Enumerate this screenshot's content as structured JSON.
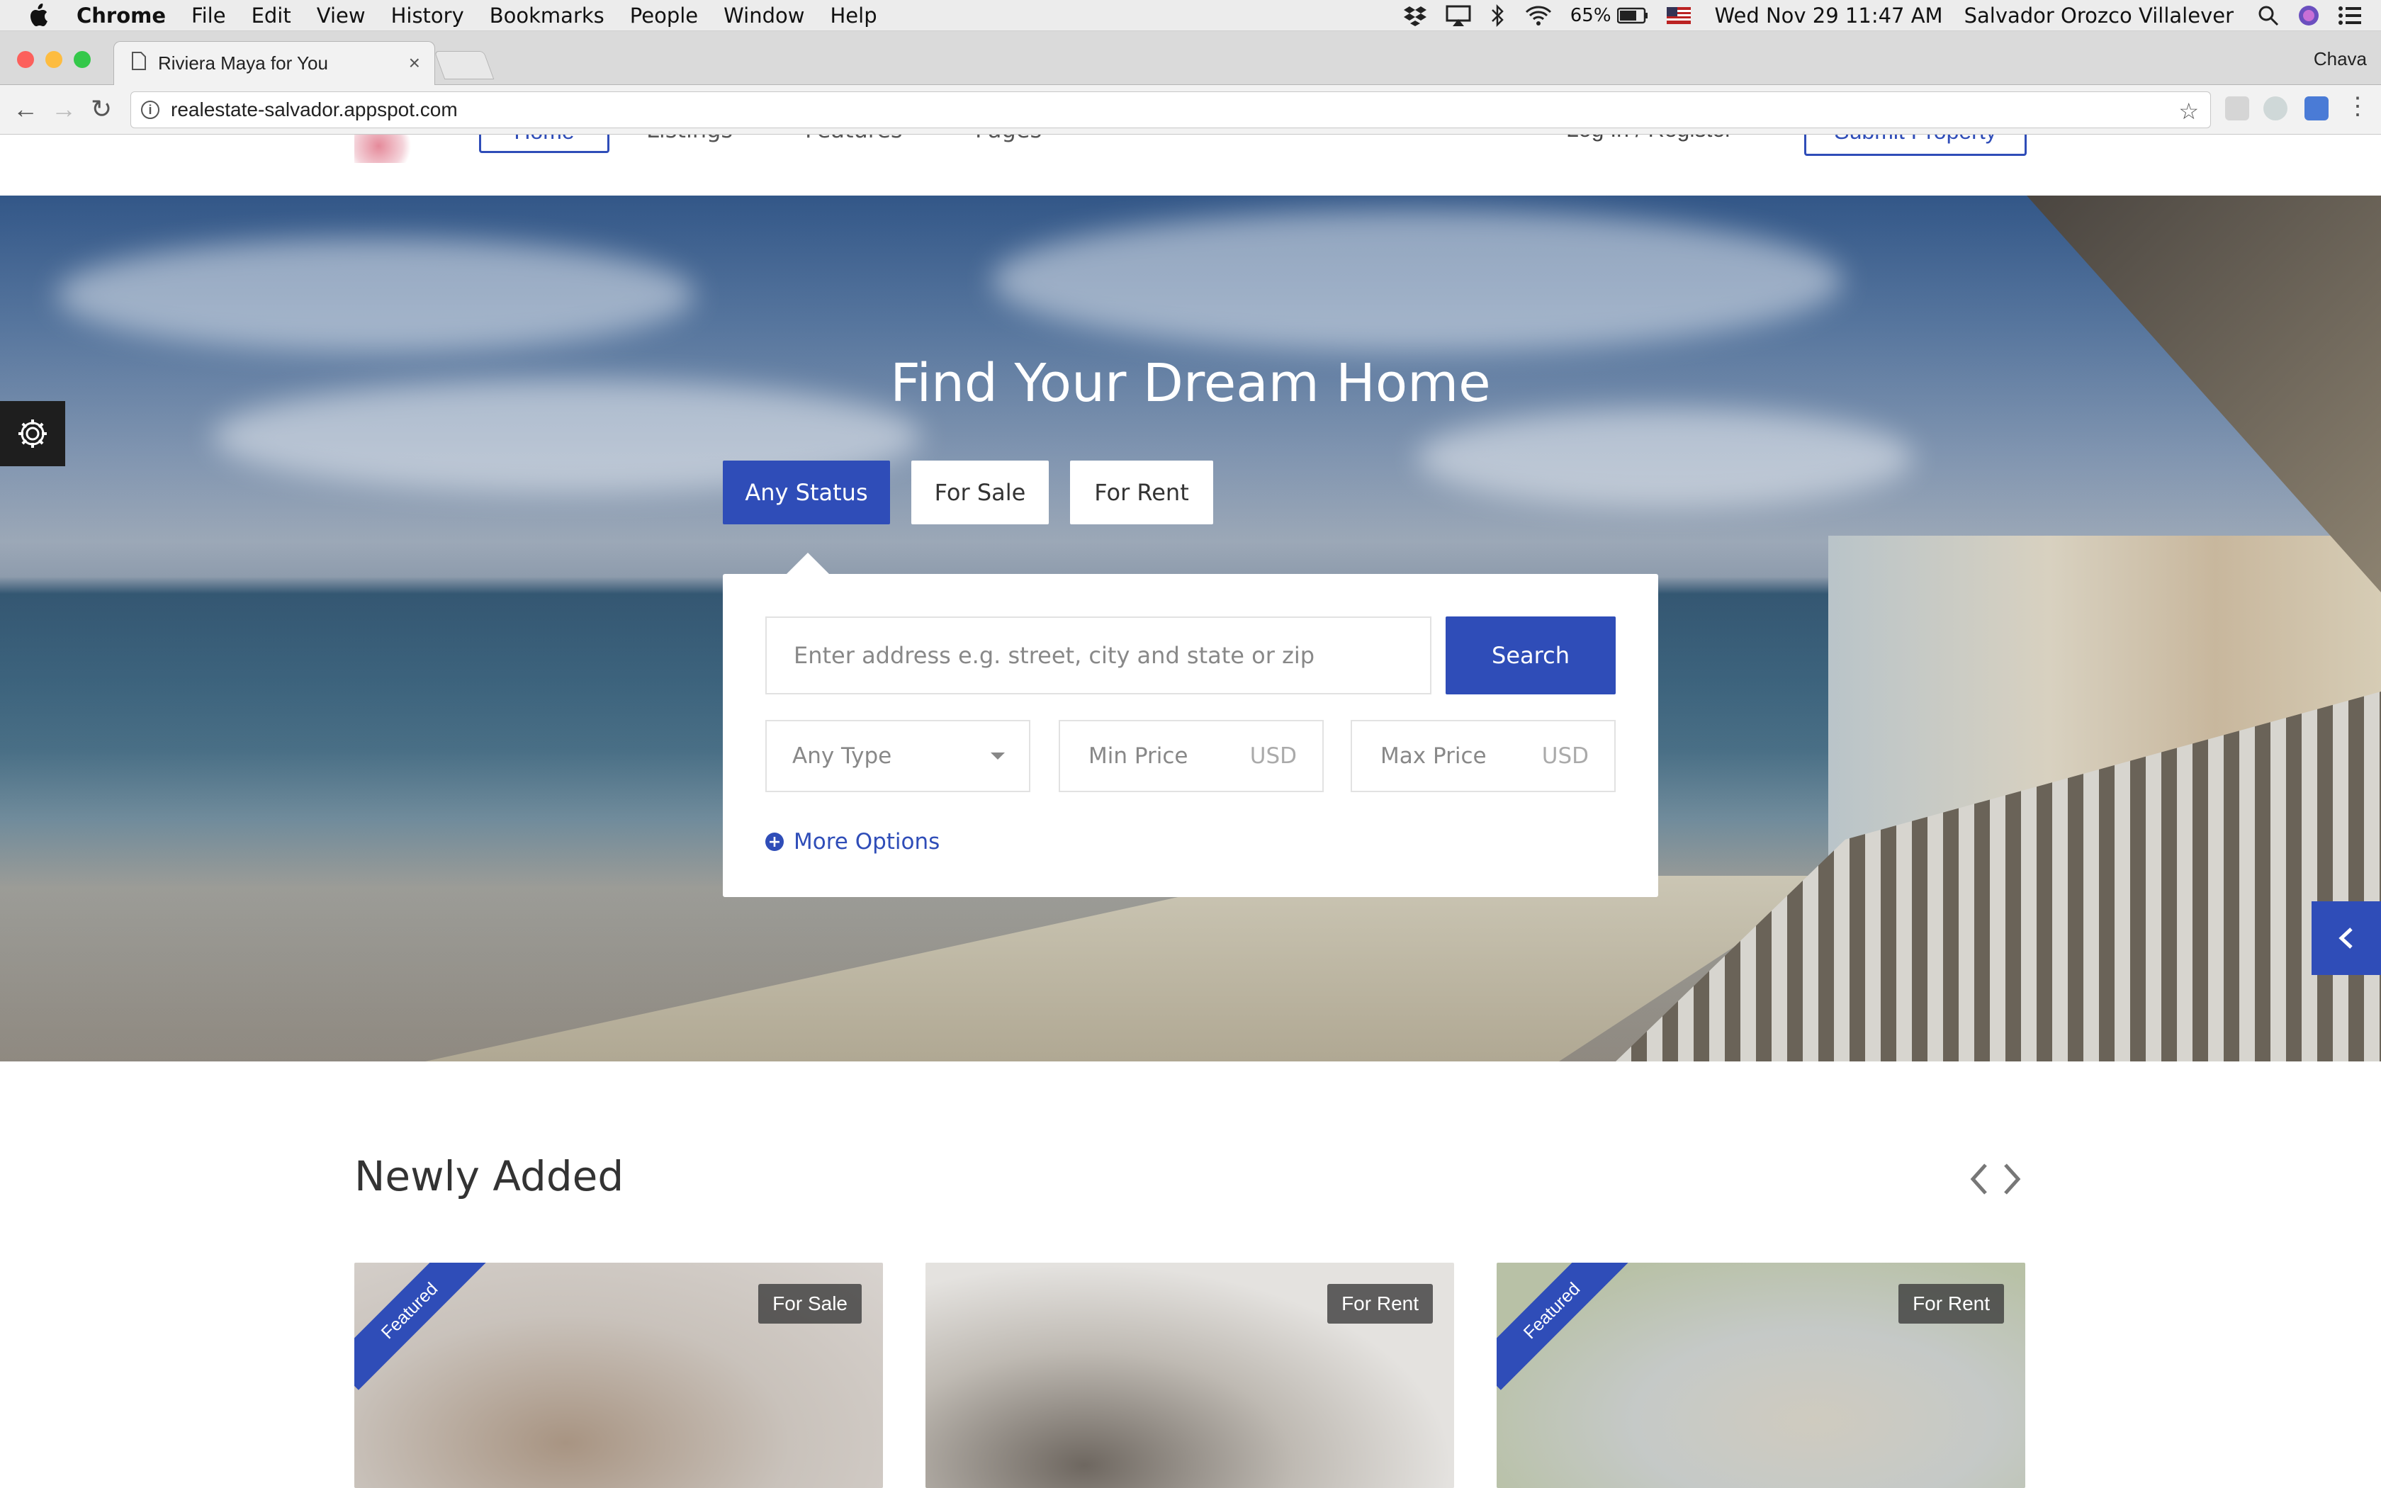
{
  "menubar": {
    "app": "Chrome",
    "items": [
      "File",
      "Edit",
      "View",
      "History",
      "Bookmarks",
      "People",
      "Window",
      "Help"
    ],
    "battery": "65%",
    "datetime": "Wed Nov 29  11:47 AM",
    "user": "Salvador Orozco Villalever"
  },
  "browser": {
    "tab_title": "Riviera Maya for You",
    "profile": "Chava",
    "url": "realestate-salvador.appspot.com"
  },
  "site_nav": {
    "home": "Home",
    "listings": "Listings",
    "features": "Features",
    "pages": "Pages",
    "login": "Log In / Register",
    "submit": "Submit Property"
  },
  "hero": {
    "title": "Find Your Dream Home",
    "status_tabs": [
      "Any Status",
      "For Sale",
      "For Rent"
    ],
    "address_placeholder": "Enter address e.g. street, city and state or zip",
    "search_label": "Search",
    "type_select": "Any Type",
    "min_price": "Min Price",
    "max_price": "Max Price",
    "currency": "USD",
    "more_options": "More Options"
  },
  "newly_added": {
    "title": "Newly Added",
    "cards": [
      {
        "status": "For Sale",
        "featured": "Featured"
      },
      {
        "status": "For Rent",
        "featured": ""
      },
      {
        "status": "For Rent",
        "featured": "Featured"
      }
    ]
  },
  "colors": {
    "accent": "#2f4db8"
  }
}
